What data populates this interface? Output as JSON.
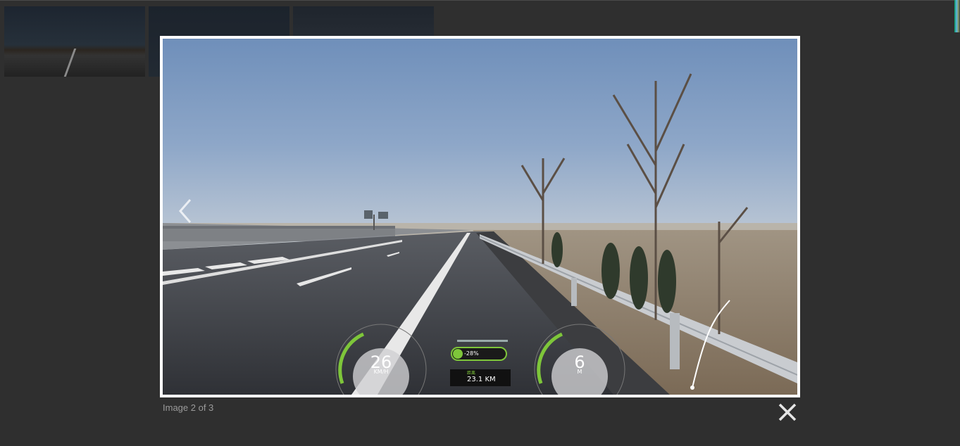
{
  "lightbox": {
    "caption": "Image 2 of 3",
    "prev_icon": "chevron-left-icon",
    "close_icon": "close-icon"
  },
  "thumbnails": [
    {
      "name": "thumbnail-1"
    },
    {
      "name": "thumbnail-2"
    },
    {
      "name": "thumbnail-3"
    }
  ],
  "hud": {
    "speed_value": "26",
    "speed_unit": "KM/H",
    "grade": "-28%",
    "distance_label": "距离",
    "distance_value": "23.1 KM",
    "altitude_value": "6",
    "altitude_unit": "M"
  },
  "colors": {
    "background": "#2f2f2f",
    "frame": "#ffffff",
    "hud_green": "#7ec63a"
  }
}
